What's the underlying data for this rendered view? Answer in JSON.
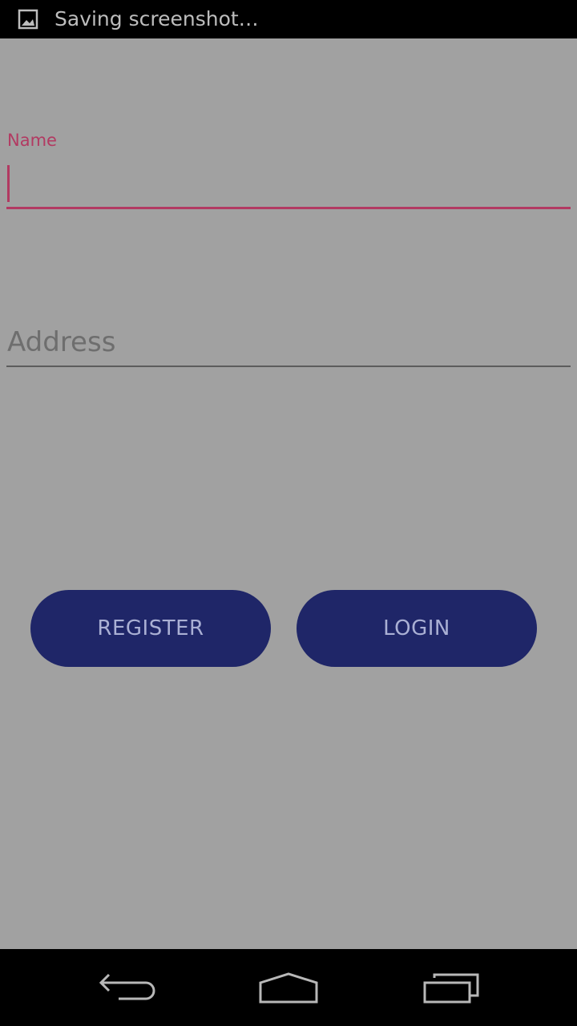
{
  "status_bar": {
    "notification_icon": "image-icon",
    "text": "Saving screenshot…"
  },
  "form": {
    "name_label": "Name",
    "name_value": "",
    "address_placeholder": "Address",
    "address_value": ""
  },
  "buttons": {
    "register_label": "REGISTER",
    "login_label": "LOGIN"
  },
  "nav_bar": {
    "back_icon": "back-icon",
    "home_icon": "home-icon",
    "recents_icon": "recents-icon"
  },
  "colors": {
    "accent": "#b23a62",
    "button": "#1f2668",
    "background": "#a1a1a1"
  }
}
